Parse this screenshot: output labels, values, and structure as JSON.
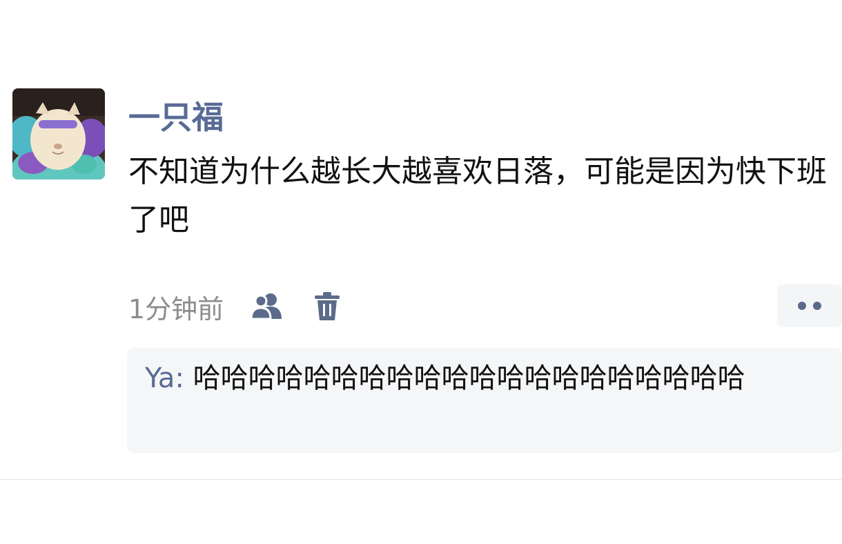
{
  "post": {
    "author": "一只福",
    "text": "不知道为什么越长大越喜欢日落，可能是因为快下班了吧",
    "time": "1分钟前",
    "avatar_icon": "fluffy-cat-avatar",
    "privacy_icon": "friends-visible-icon",
    "delete_icon": "trash-icon",
    "more_icon": "two-dots-icon"
  },
  "comments": [
    {
      "author": "Ya",
      "separator": ": ",
      "text": "哈哈哈哈哈哈哈哈哈哈哈哈哈哈哈哈哈哈哈哈"
    }
  ],
  "colors": {
    "name_link": "#586b95",
    "body_text": "#111111",
    "meta_text": "#8c8c8c",
    "comment_bg": "#f5f6f7"
  }
}
